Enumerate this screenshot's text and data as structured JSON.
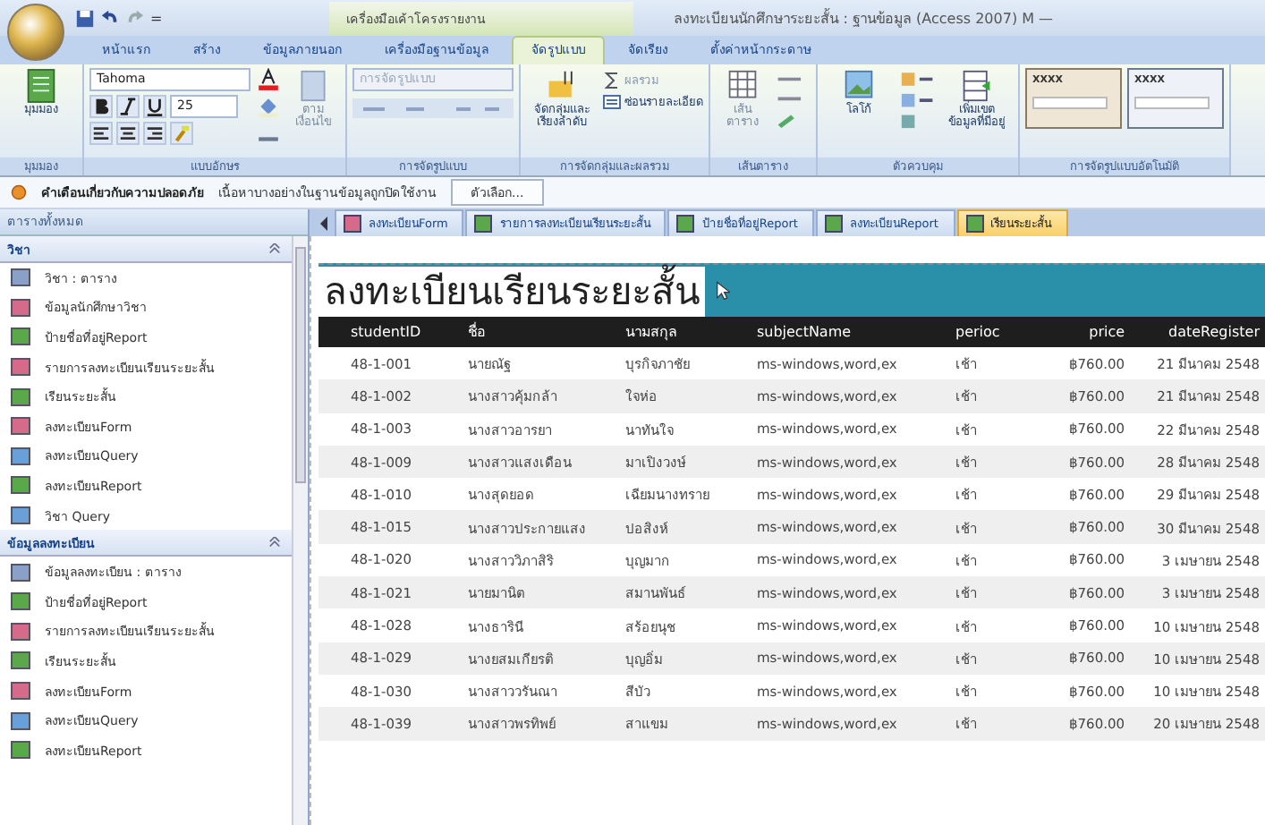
{
  "window": {
    "title": "ลงทะเบียนนักศึกษาระยะสั้น : ฐานข้อมูล (Access 2007) M  —",
    "context_tab_group": "เครื่องมือเค้าโครงรายงาน"
  },
  "quick_access": {
    "separator": "="
  },
  "ribbon_tabs": [
    {
      "label": "หน้าแรก",
      "selected": false
    },
    {
      "label": "สร้าง",
      "selected": false
    },
    {
      "label": "ข้อมูลภายนอก",
      "selected": false
    },
    {
      "label": "เครื่องมือฐานข้อมูล",
      "selected": false
    },
    {
      "label": "จัดรูปแบบ",
      "selected": true
    },
    {
      "label": "จัดเรียง",
      "selected": false
    },
    {
      "label": "ตั้งค่าหน้ากระดาษ",
      "selected": false
    }
  ],
  "ribbon_groups": [
    {
      "kind": "views",
      "label": "มุมมอง",
      "buttons": [
        "มุมมอง"
      ]
    },
    {
      "kind": "font",
      "label": "แบบอักษร",
      "font_name": "Tahoma",
      "font_size": "25",
      "buttons": [
        "ตาม เงื่อนไข"
      ]
    },
    {
      "kind": "formatting",
      "label": "การจัดรูปแบบ",
      "placeholder": "การจัดรูปแบบ"
    },
    {
      "kind": "grouping",
      "label": "การจัดกลุ่มและผลรวม",
      "buttons": [
        "จัดกลุ่มและ เรียงลำดับ",
        "ผลรวม",
        "ซ่อนรายละเอียด"
      ]
    },
    {
      "kind": "gridlines",
      "label": "เส้นตาราง",
      "buttons": [
        "เส้น ตาราง"
      ]
    },
    {
      "kind": "controls",
      "label": "ตัวควบคุม",
      "buttons": [
        "โลโก้",
        "เพิ่มเขต ข้อมูลที่มีอยู่"
      ]
    },
    {
      "kind": "autoformat",
      "label": "การจัดรูปแบบอัตโนมัติ",
      "buttons": [
        "XXXX",
        "XXXX"
      ]
    }
  ],
  "security_bar": {
    "title": "คำเตือนเกี่ยวกับความปลอดภัย",
    "message": "เนื้อหาบางอย่างในฐานข้อมูลถูกปิดใช้งาน",
    "button": "ตัวเลือก..."
  },
  "navigation": {
    "title": "ตารางทั้งหมด",
    "groups": [
      {
        "label": "วิชา",
        "expanded": true,
        "items": [
          {
            "kind": "table",
            "label": "วิชา : ตาราง"
          },
          {
            "kind": "form",
            "label": "ข้อมูลนักศึกษาวิชา"
          },
          {
            "kind": "report",
            "label": "ป้ายชื่อที่อยู่Report"
          },
          {
            "kind": "form",
            "label": "รายการลงทะเบียนเรียนระยะสั้น"
          },
          {
            "kind": "report",
            "label": "เรียนระยะสั้น"
          },
          {
            "kind": "form",
            "label": "ลงทะเบียนForm"
          },
          {
            "kind": "query",
            "label": "ลงทะเบียนQuery"
          },
          {
            "kind": "report",
            "label": "ลงทะเบียนReport"
          },
          {
            "kind": "query",
            "label": "วิชา Query"
          }
        ]
      },
      {
        "label": "ข้อมูลลงทะเบียน",
        "expanded": true,
        "items": [
          {
            "kind": "table",
            "label": "ข้อมูลลงทะเบียน : ตาราง"
          },
          {
            "kind": "report",
            "label": "ป้ายชื่อที่อยู่Report"
          },
          {
            "kind": "form",
            "label": "รายการลงทะเบียนเรียนระยะสั้น"
          },
          {
            "kind": "report",
            "label": "เรียนระยะสั้น"
          },
          {
            "kind": "form",
            "label": "ลงทะเบียนForm"
          },
          {
            "kind": "query",
            "label": "ลงทะเบียนQuery"
          },
          {
            "kind": "report",
            "label": "ลงทะเบียนReport"
          }
        ]
      }
    ]
  },
  "document_tabs": [
    {
      "kind": "form",
      "label": "ลงทะเบียนForm",
      "selected": false
    },
    {
      "kind": "report",
      "label": "รายการลงทะเบียนเรียนระยะสั้น",
      "selected": false
    },
    {
      "kind": "report",
      "label": "ป้ายชื่อที่อยู่Report",
      "selected": false
    },
    {
      "kind": "report",
      "label": "ลงทะเบียนReport",
      "selected": false
    },
    {
      "kind": "report",
      "label": "เรียนระยะสั้น",
      "selected": true
    }
  ],
  "report": {
    "title": "ลงทะเบียนเรียนระยะสั้น",
    "columns": [
      "studentID",
      "ชื่อ",
      "นามสกุล",
      "subjectName",
      "perioc",
      "price",
      "dateRegister"
    ],
    "rows": [
      [
        "48-1-001",
        "นายณัฐ",
        "บุรกิจภาชัย",
        "ms-windows,word,ex",
        "เช้า",
        "฿760.00",
        "21 มีนาคม 2548"
      ],
      [
        "48-1-002",
        "นางสาวคุ้มกล้า",
        "ใจห่อ",
        "ms-windows,word,ex",
        "เช้า",
        "฿760.00",
        "21 มีนาคม 2548"
      ],
      [
        "48-1-003",
        "นางสาวอารยา",
        "นาทันใจ",
        "ms-windows,word,ex",
        "เช้า",
        "฿760.00",
        "22 มีนาคม 2548"
      ],
      [
        "48-1-009",
        "นางสาวแสงเดือน",
        "มาเปิงวงษ์",
        "ms-windows,word,ex",
        "เช้า",
        "฿760.00",
        "28 มีนาคม 2548"
      ],
      [
        "48-1-010",
        "นางสุดยอด",
        "เฉียมนางทราย",
        "ms-windows,word,ex",
        "เช้า",
        "฿760.00",
        "29 มีนาคม 2548"
      ],
      [
        "48-1-015",
        "นางสาวประกายแสง",
        "ปอสิงห์",
        "ms-windows,word,ex",
        "เช้า",
        "฿760.00",
        "30 มีนาคม 2548"
      ],
      [
        "48-1-020",
        "นางสาววิภาสิริ",
        "บุญมาก",
        "ms-windows,word,ex",
        "เช้า",
        "฿760.00",
        "3 เมษายน 2548"
      ],
      [
        "48-1-021",
        "นายมานิต",
        "สมานพันธ์",
        "ms-windows,word,ex",
        "เช้า",
        "฿760.00",
        "3 เมษายน 2548"
      ],
      [
        "48-1-028",
        "นางธารินี",
        "สร้อยนุช",
        "ms-windows,word,ex",
        "เช้า",
        "฿760.00",
        "10 เมษายน 2548"
      ],
      [
        "48-1-029",
        "นางยสมเกียรติ",
        "บุญอิ่ม",
        "ms-windows,word,ex",
        "เช้า",
        "฿760.00",
        "10 เมษายน 2548"
      ],
      [
        "48-1-030",
        "นางสาววรันณา",
        "สีบัว",
        "ms-windows,word,ex",
        "เช้า",
        "฿760.00",
        "10 เมษายน 2548"
      ],
      [
        "48-1-039",
        "นางสาวพรทิพย์",
        "สาแขม",
        "ms-windows,word,ex",
        "เช้า",
        "฿760.00",
        "20 เมษายน 2548"
      ]
    ]
  }
}
